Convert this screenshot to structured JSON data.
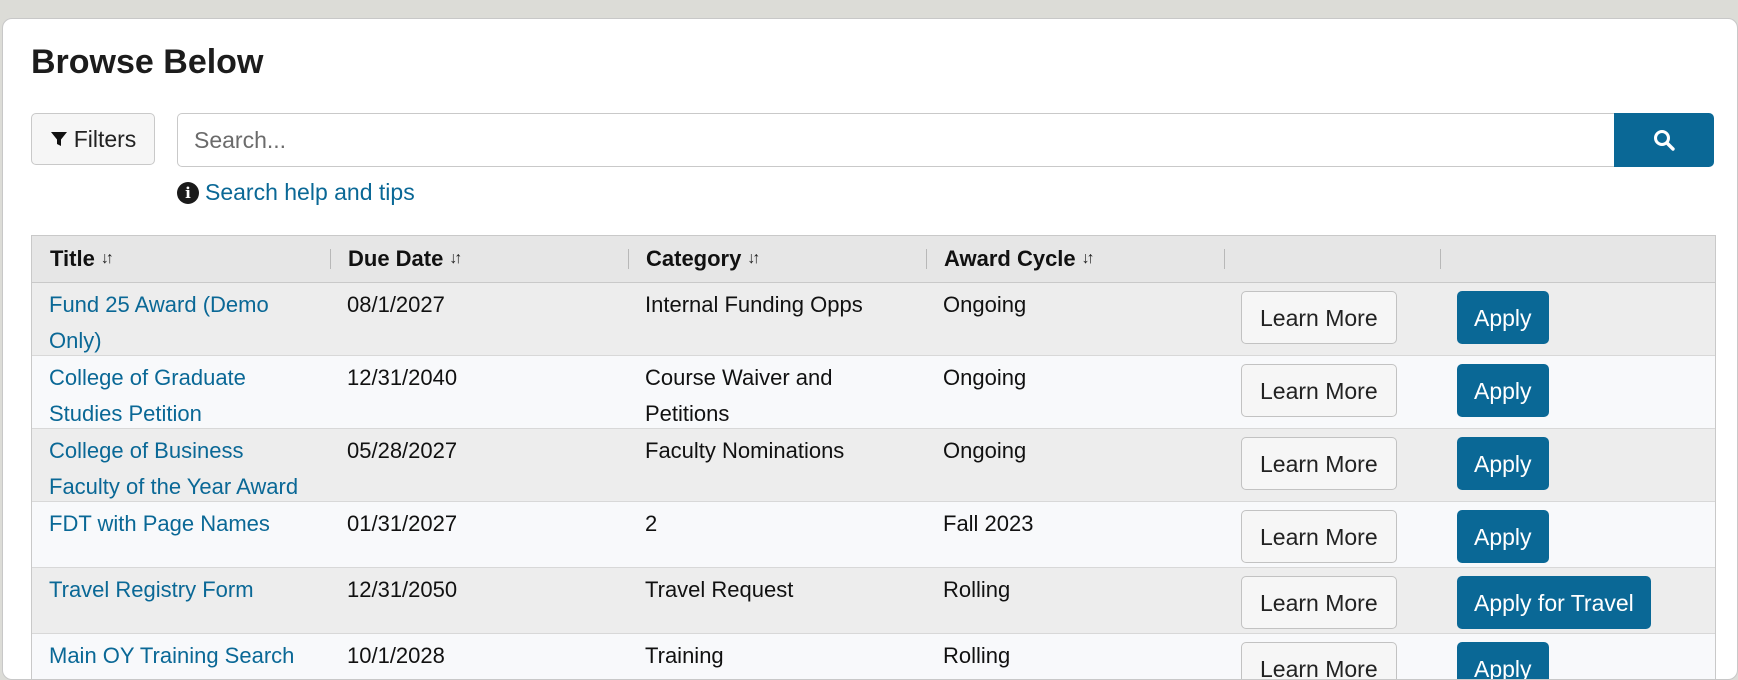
{
  "page": {
    "title": "Browse Below"
  },
  "toolbar": {
    "filters_label": "Filters",
    "filter_icon": "filter-icon"
  },
  "search": {
    "placeholder": "Search...",
    "value": "",
    "button_icon": "search-icon",
    "help_label": "Search help and tips",
    "help_icon": "info-icon"
  },
  "table": {
    "columns": [
      "Title",
      "Due Date",
      "Category",
      "Award Cycle",
      "",
      ""
    ],
    "sort_icon": "sort-arrows-icon",
    "rows": [
      {
        "title": "Fund 25 Award (Demo Only)",
        "due_date": "08/1/2027",
        "category": "Internal Funding Opps",
        "award_cycle": "Ongoing",
        "learn_more": "Learn More",
        "apply": "Apply"
      },
      {
        "title": "College of Graduate Studies Petition",
        "due_date": "12/31/2040",
        "category": "Course Waiver and Petitions",
        "award_cycle": "Ongoing",
        "learn_more": "Learn More",
        "apply": "Apply"
      },
      {
        "title": "College of Business Faculty of the Year Award",
        "due_date": "05/28/2027",
        "category": "Faculty Nominations",
        "award_cycle": "Ongoing",
        "learn_more": "Learn More",
        "apply": "Apply"
      },
      {
        "title": "FDT with Page Names",
        "due_date": "01/31/2027",
        "category": "2",
        "award_cycle": "Fall 2023",
        "learn_more": "Learn More",
        "apply": "Apply"
      },
      {
        "title": "Travel Registry Form",
        "due_date": "12/31/2050",
        "category": "Travel Request",
        "award_cycle": "Rolling",
        "learn_more": "Learn More",
        "apply": "Apply for Travel"
      },
      {
        "title": "Main OY Training Search",
        "due_date": "10/1/2028",
        "category": "Training",
        "award_cycle": "Rolling",
        "learn_more": "Learn More",
        "apply": "Apply"
      }
    ]
  },
  "colors": {
    "accent": "#0a6896",
    "header_bg": "#e6e6e6",
    "row_odd": "#ededed",
    "row_even": "#f8f9fb"
  }
}
